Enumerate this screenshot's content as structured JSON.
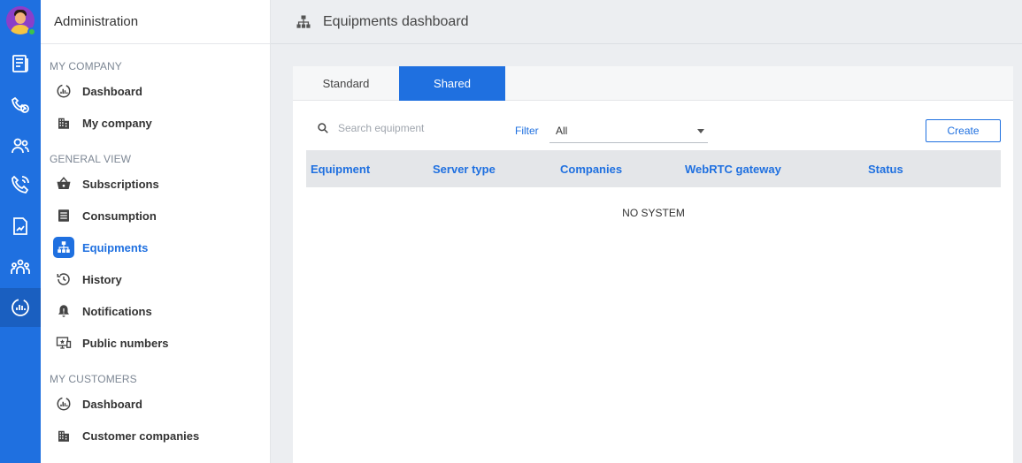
{
  "rail": {
    "icons": [
      "newspaper-icon",
      "phone-cycle-icon",
      "users-icon",
      "phone-call-icon",
      "document-icon",
      "group-icon",
      "dashboard-gauge-icon"
    ],
    "active_index": 6,
    "accent": "#1f70e0"
  },
  "sidebar": {
    "title": "Administration",
    "sections": [
      {
        "label": "MY COMPANY",
        "items": [
          {
            "label": "Dashboard",
            "icon": "dashboard-gauge-icon"
          },
          {
            "label": "My company",
            "icon": "building-icon"
          }
        ]
      },
      {
        "label": "GENERAL VIEW",
        "items": [
          {
            "label": "Subscriptions",
            "icon": "basket-icon"
          },
          {
            "label": "Consumption",
            "icon": "list-icon"
          },
          {
            "label": "Equipments",
            "icon": "network-icon",
            "active": true
          },
          {
            "label": "History",
            "icon": "history-icon"
          },
          {
            "label": "Notifications",
            "icon": "bell-icon"
          },
          {
            "label": "Public numbers",
            "icon": "monitor-star-icon"
          }
        ]
      },
      {
        "label": "MY CUSTOMERS",
        "items": [
          {
            "label": "Dashboard",
            "icon": "dashboard-gauge-icon"
          },
          {
            "label": "Customer companies",
            "icon": "building-icon"
          }
        ]
      }
    ]
  },
  "header": {
    "title": "Equipments dashboard",
    "icon": "network-icon"
  },
  "main": {
    "tabs": [
      {
        "label": "Standard",
        "active": false
      },
      {
        "label": "Shared",
        "active": true
      }
    ],
    "search": {
      "placeholder": "Search equipment",
      "value": ""
    },
    "filter": {
      "label": "Filter",
      "value": "All"
    },
    "create_label": "Create",
    "table": {
      "columns": [
        "Equipment",
        "Server type",
        "Companies",
        "WebRTC gateway",
        "Status"
      ],
      "rows": [],
      "empty_text": "NO SYSTEM"
    }
  }
}
